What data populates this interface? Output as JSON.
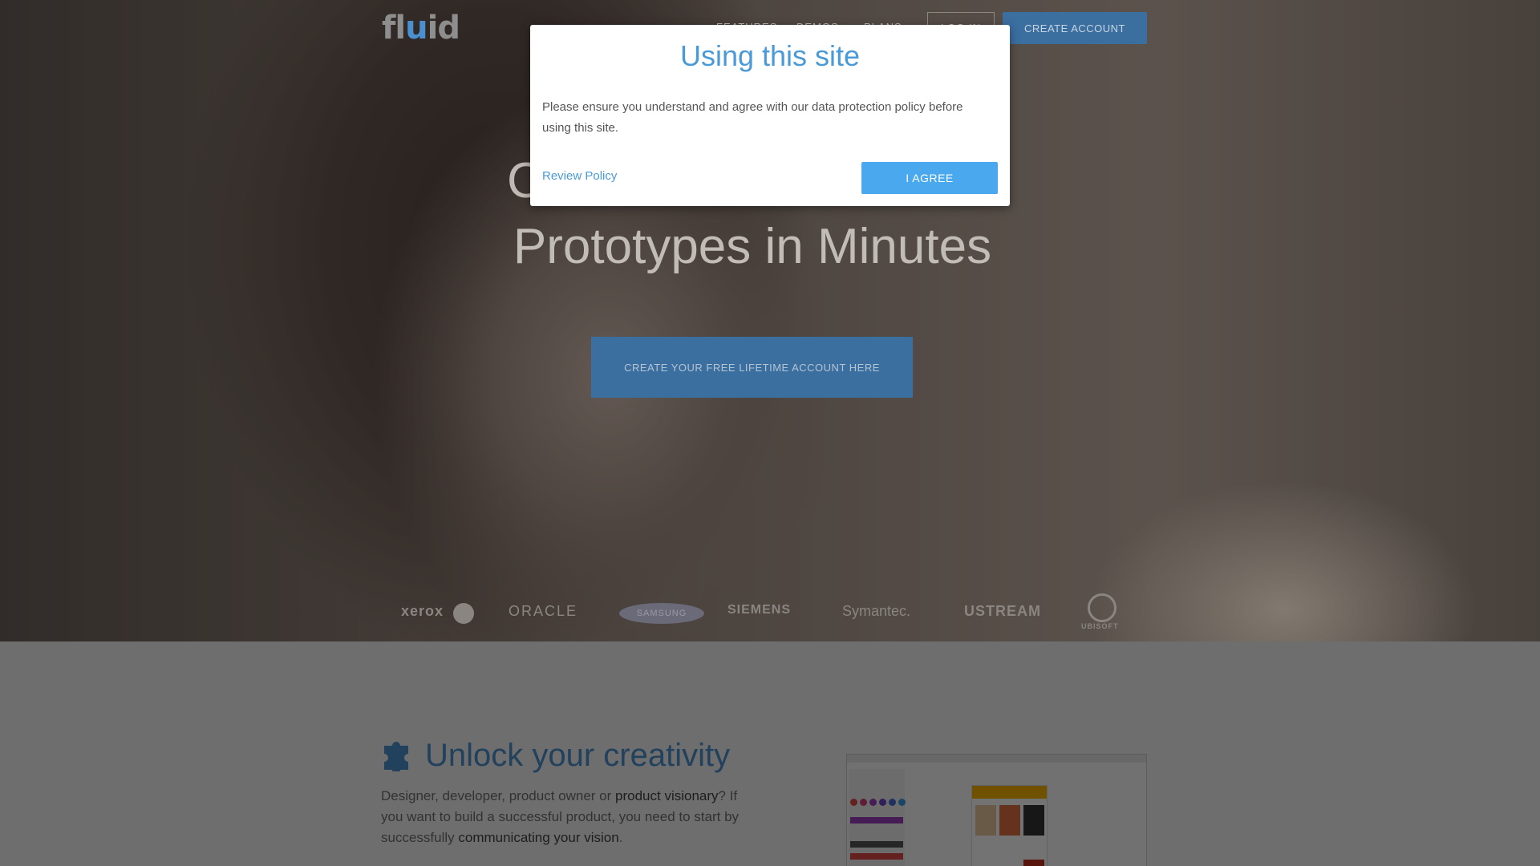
{
  "header": {
    "logo": {
      "prefix": "fl",
      "accent": "u",
      "suffix": "id"
    },
    "nav": [
      "FEATURES",
      "DEMOS",
      "PLANS"
    ],
    "login_label": "LOG IN",
    "create_account_label": "CREATE ACCOUNT"
  },
  "hero": {
    "title_partial": "C",
    "title_line_2": "Prototypes in Minutes",
    "cta_label": "CREATE YOUR FREE LIFETIME ACCOUNT HERE"
  },
  "client_logos": {
    "xerox": "xerox",
    "oracle": "ORACLE",
    "samsung": "SAMSUNG",
    "siemens": "SIEMENS",
    "symantec": "Symantec.",
    "ustream": "USTREAM",
    "ubisoft": "UBISOFT"
  },
  "feature": {
    "icon": "puzzle-icon",
    "title": "Unlock your creativity",
    "text_1": "Designer, developer, product owner or ",
    "text_bold_1": "product visionary",
    "text_2": "? If you want to build a successful product, you need to start by successfully ",
    "text_bold_2": "communicating your vision",
    "text_3": "."
  },
  "modal": {
    "title": "Using this site",
    "body": "Please ensure you understand and agree with our data protection policy before using this site.",
    "review_link": "Review Policy",
    "agree_label": "I AGREE"
  },
  "colors": {
    "accent": "#4a9ad8",
    "agree_button": "#4aa8ee",
    "brand_blue": "#3b6fa0"
  }
}
